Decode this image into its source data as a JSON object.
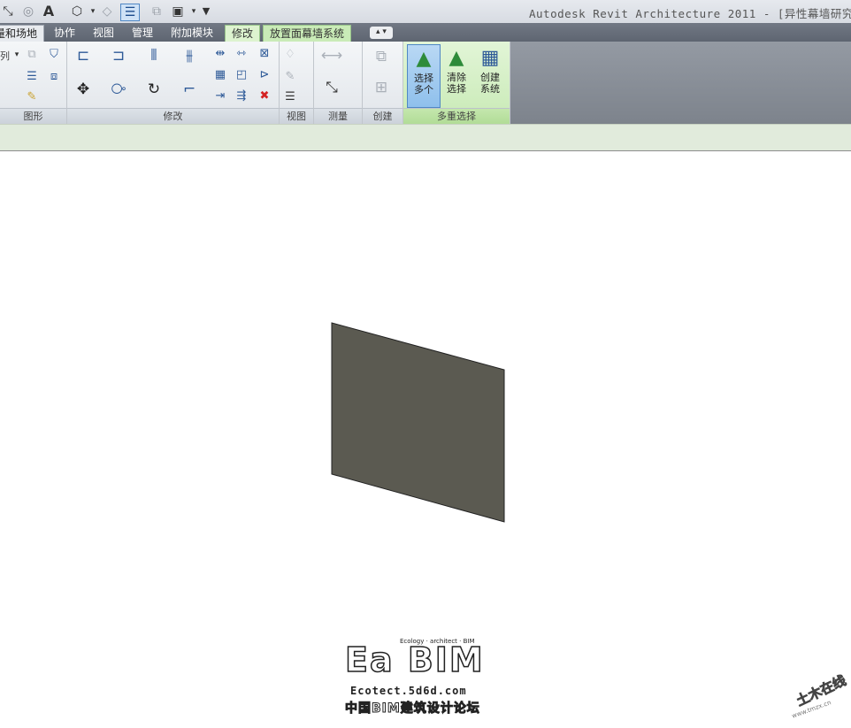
{
  "window": {
    "title": "Autodesk Revit Architecture 2011 - [异性幕墙研究"
  },
  "qat": {
    "text_tool": "A",
    "dropdown_glyph": "▾",
    "icons": [
      "dimension-icon",
      "tag-icon",
      "text-icon",
      "3d-view-icon",
      "section-icon",
      "thin-lines-icon",
      "close-windows-icon",
      "switch-windows-icon",
      "customize-icon"
    ]
  },
  "tabs": [
    {
      "label": "体量和场地",
      "visible": "量和场地"
    },
    {
      "label": "协作"
    },
    {
      "label": "视图"
    },
    {
      "label": "管理"
    },
    {
      "label": "附加模块"
    },
    {
      "label": "修改"
    },
    {
      "label": "放置面幕墙系统"
    },
    {
      "label": "▴ ▾"
    }
  ],
  "panels": {
    "graphics": "图形",
    "graphics_dropdown_label": "列",
    "modify": "修改",
    "view": "视图",
    "measure": "测量",
    "create": "创建",
    "multi_select": "多重选择"
  },
  "multi_select": {
    "select_multiple": [
      "选择",
      "多个"
    ],
    "clear_selection": [
      "清除",
      "选择"
    ],
    "create_system": [
      "创建",
      "系统"
    ]
  },
  "canvas": {
    "panel_fill": "#5b5a51"
  },
  "logo": {
    "big_text": "Ea BIM",
    "tagline": "Ecology · architect · BIM",
    "url": "Ecotect.5d6d.com",
    "chinese": "中国BIM建筑设计论坛"
  },
  "watermark": {
    "text": "土木在线",
    "url": "www.tmzx.cn"
  },
  "colors": {
    "accent_blue": "#2e5a98",
    "green_tab": "#c9ebb7",
    "tab_bar": "#6a717d"
  }
}
